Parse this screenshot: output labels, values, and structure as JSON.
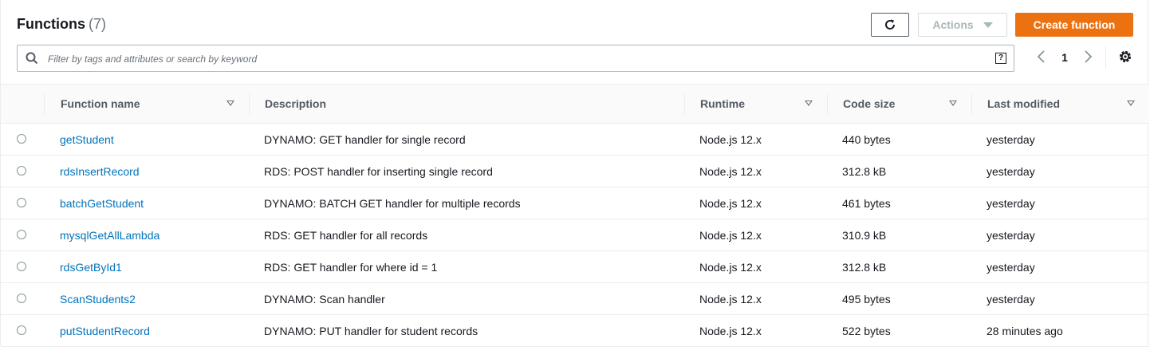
{
  "header": {
    "title": "Functions",
    "count": "(7)"
  },
  "toolbar": {
    "refresh_icon": "refresh-icon",
    "actions_label": "Actions",
    "create_label": "Create function"
  },
  "search": {
    "placeholder": "Filter by tags and attributes or search by keyword",
    "value": "",
    "help_glyph": "?"
  },
  "pagination": {
    "current_page": "1"
  },
  "columns": {
    "name": "Function name",
    "description": "Description",
    "runtime": "Runtime",
    "code_size": "Code size",
    "last_modified": "Last modified"
  },
  "rows": [
    {
      "name": "getStudent",
      "description": "DYNAMO: GET handler for single record",
      "runtime": "Node.js 12.x",
      "code_size": "440 bytes",
      "last_modified": "yesterday"
    },
    {
      "name": "rdsInsertRecord",
      "description": "RDS: POST handler for inserting single record",
      "runtime": "Node.js 12.x",
      "code_size": "312.8 kB",
      "last_modified": "yesterday"
    },
    {
      "name": "batchGetStudent",
      "description": "DYNAMO: BATCH GET handler for multiple records",
      "runtime": "Node.js 12.x",
      "code_size": "461 bytes",
      "last_modified": "yesterday"
    },
    {
      "name": "mysqlGetAllLambda",
      "description": "RDS: GET handler for all records",
      "runtime": "Node.js 12.x",
      "code_size": "310.9 kB",
      "last_modified": "yesterday"
    },
    {
      "name": "rdsGetById1",
      "description": "RDS: GET handler for where id = 1",
      "runtime": "Node.js 12.x",
      "code_size": "312.8 kB",
      "last_modified": "yesterday"
    },
    {
      "name": "ScanStudents2",
      "description": "DYNAMO: Scan handler",
      "runtime": "Node.js 12.x",
      "code_size": "495 bytes",
      "last_modified": "yesterday"
    },
    {
      "name": "putStudentRecord",
      "description": "DYNAMO: PUT handler for student records",
      "runtime": "Node.js 12.x",
      "code_size": "522 bytes",
      "last_modified": "28 minutes ago"
    }
  ],
  "colors": {
    "primary_button": "#ec7211",
    "link": "#0073bb",
    "text": "#16191f",
    "muted": "#687078"
  }
}
